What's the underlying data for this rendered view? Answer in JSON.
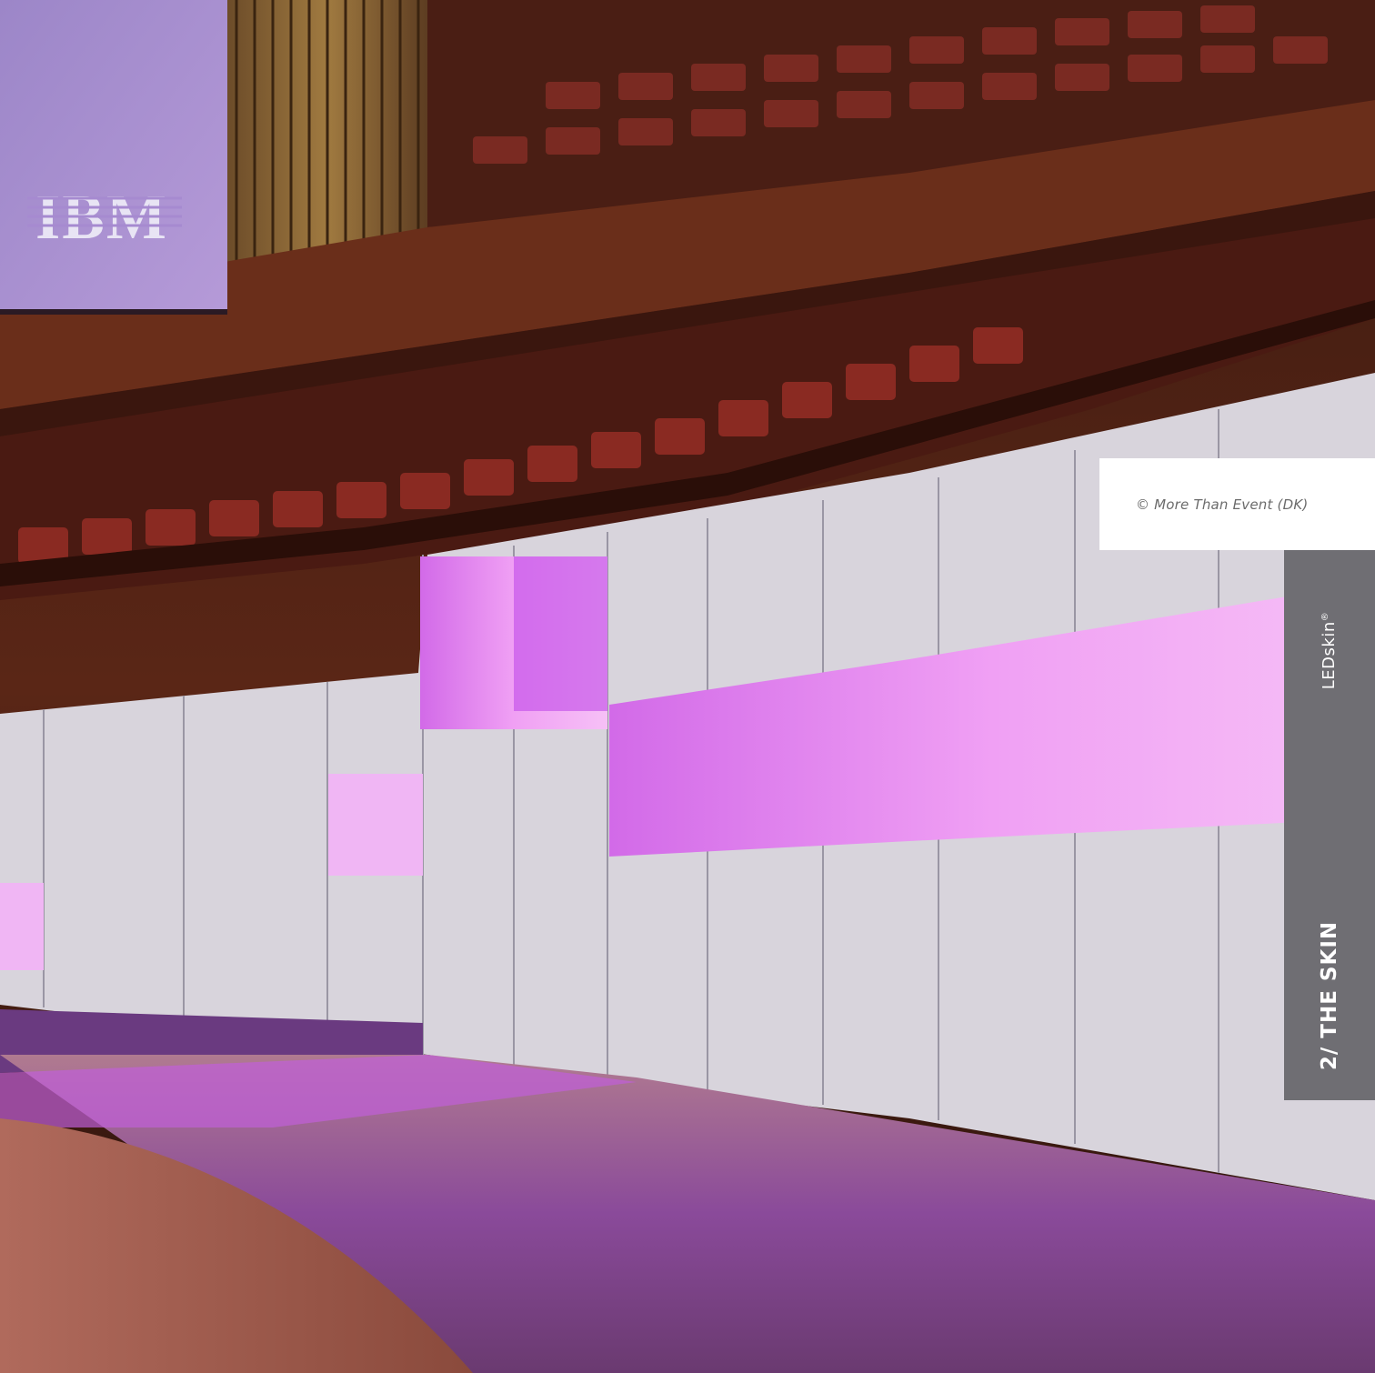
{
  "photo": {
    "screen_logo": "IBM",
    "palette": {
      "hall_dark": "#2a1410",
      "wood": "#7a3a22",
      "seat_red": "#8a2a22",
      "panel_white": "#d8d4dc",
      "led_magenta": "#e27af0",
      "screen_lavender": "#a68ad0"
    }
  },
  "credit": {
    "text": "© More Than Event (DK)"
  },
  "side_tab": {
    "brand": "LEDskin",
    "brand_mark": "®",
    "section": "2/ THE SKIN",
    "color": "#6f6e73"
  }
}
